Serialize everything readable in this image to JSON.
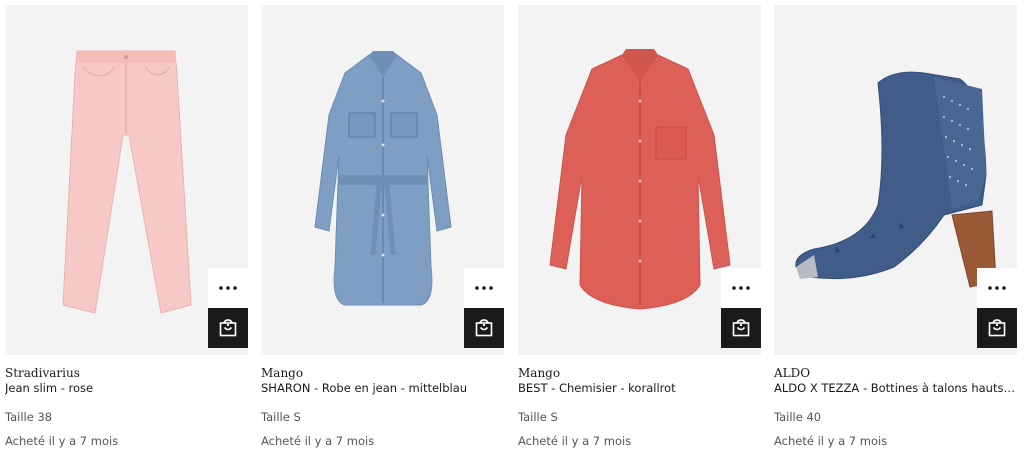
{
  "accent_color": "#1a1a1a",
  "items": [
    {
      "brand": "Stradivarius",
      "name": "Jean slim - rose",
      "size": "Taille 38",
      "bought": "Acheté il y a 7 mois",
      "product_color": "#f5c5c3",
      "image_icon": "pink-jeans-image"
    },
    {
      "brand": "Mango",
      "name": "SHARON - Robe en jean - mittelblau",
      "size": "Taille S",
      "bought": "Acheté il y a 7 mois",
      "product_color": "#7f9ec2",
      "image_icon": "denim-dress-image"
    },
    {
      "brand": "Mango",
      "name": "BEST - Chemisier - korallrot",
      "size": "Taille S",
      "bought": "Acheté il y a 7 mois",
      "product_color": "#dc5f55",
      "image_icon": "coral-shirt-image"
    },
    {
      "brand": "ALDO",
      "name": "ALDO X TEZZA - Bottines à talons hauts ...",
      "size": "Taille 40",
      "bought": "Acheté il y a 7 mois",
      "product_color": "#3f5a86",
      "image_icon": "blue-boot-image"
    }
  ],
  "more_options_icon": "ellipsis-icon",
  "add_to_bag_icon": "shopping-bag-icon"
}
